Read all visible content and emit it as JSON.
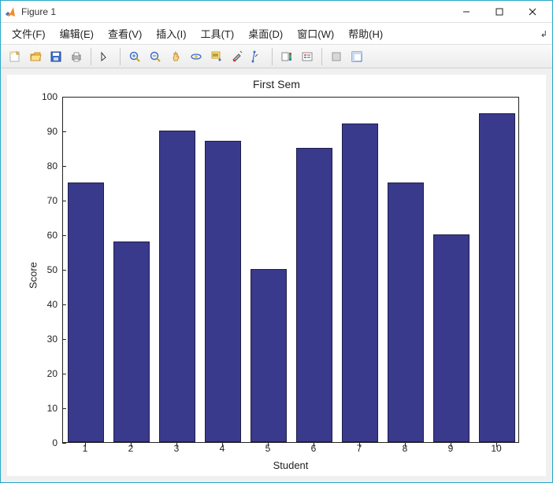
{
  "window": {
    "title": "Figure 1"
  },
  "menus": {
    "file": "文件(F)",
    "edit": "编辑(E)",
    "view": "查看(V)",
    "insert": "插入(I)",
    "tools": "工具(T)",
    "desktop": "桌面(D)",
    "window": "窗口(W)",
    "help": "帮助(H)"
  },
  "chart_data": {
    "type": "bar",
    "title": "First Sem",
    "xlabel": "Student",
    "ylabel": "Score",
    "categories": [
      "1",
      "2",
      "3",
      "4",
      "5",
      "6",
      "7",
      "8",
      "9",
      "10"
    ],
    "values": [
      75,
      58,
      90,
      87,
      50,
      85,
      92,
      75,
      60,
      95
    ],
    "ylim": [
      0,
      100
    ],
    "yticks": [
      0,
      10,
      20,
      30,
      40,
      50,
      60,
      70,
      80,
      90,
      100
    ],
    "bar_color": "#3a3a8c"
  }
}
